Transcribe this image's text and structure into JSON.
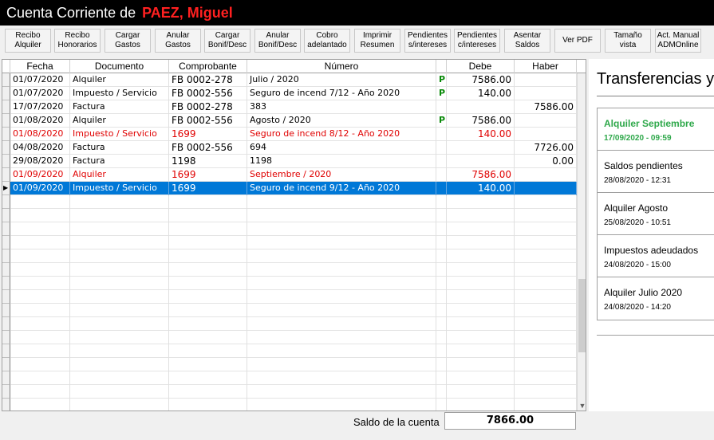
{
  "window": {
    "title_prefix": "Cuenta Corriente de",
    "client_name": "PAEZ, Miguel"
  },
  "toolbar": [
    "Recibo\nAlquiler",
    "Recibo\nHonorarios",
    "Cargar\nGastos",
    "Anular\nGastos",
    "Cargar\nBonif/Desc",
    "Anular\nBonif/Desc",
    "Cobro\nadelantado",
    "Imprimir\nResumen",
    "Pendientes\ns/intereses",
    "Pendientes\nc/intereses",
    "Asentar\nSaldos",
    "Ver PDF",
    "Tamaño vista",
    "Act. Manual\nADMOnline"
  ],
  "grid": {
    "columns": [
      "Fecha",
      "Documento",
      "Comprobante",
      "Número",
      "",
      "Debe",
      "Haber"
    ],
    "rows": [
      {
        "fecha": "01/07/2020",
        "documento": "Alquiler",
        "comprobante": "FB 0002-278",
        "numero": "Julio / 2020",
        "flag": "P",
        "debe": "7586.00",
        "haber": "",
        "style": "normal"
      },
      {
        "fecha": "01/07/2020",
        "documento": "Impuesto / Servicio",
        "comprobante": "FB 0002-556",
        "numero": "Seguro de incend 7/12 - Año 2020",
        "flag": "P",
        "debe": "140.00",
        "haber": "",
        "style": "normal"
      },
      {
        "fecha": "17/07/2020",
        "documento": "Factura",
        "comprobante": "FB 0002-278",
        "numero": "383",
        "flag": "",
        "debe": "",
        "haber": "7586.00",
        "style": "normal"
      },
      {
        "fecha": "01/08/2020",
        "documento": "Alquiler",
        "comprobante": "FB 0002-556",
        "numero": "Agosto / 2020",
        "flag": "P",
        "debe": "7586.00",
        "haber": "",
        "style": "normal"
      },
      {
        "fecha": "01/08/2020",
        "documento": "Impuesto / Servicio",
        "comprobante": "1699",
        "numero": "Seguro de incend 8/12 - Año 2020",
        "flag": "",
        "debe": "140.00",
        "haber": "",
        "style": "red"
      },
      {
        "fecha": "04/08/2020",
        "documento": "Factura",
        "comprobante": "FB 0002-556",
        "numero": "694",
        "flag": "",
        "debe": "",
        "haber": "7726.00",
        "style": "normal"
      },
      {
        "fecha": "29/08/2020",
        "documento": "Factura",
        "comprobante": "1198",
        "numero": "1198",
        "flag": "",
        "debe": "",
        "haber": "0.00",
        "style": "normal"
      },
      {
        "fecha": "01/09/2020",
        "documento": "Alquiler",
        "comprobante": "1699",
        "numero": "Septiembre / 2020",
        "flag": "",
        "debe": "7586.00",
        "haber": "",
        "style": "red"
      },
      {
        "fecha": "01/09/2020",
        "documento": "Impuesto / Servicio",
        "comprobante": "1699",
        "numero": "Seguro de incend 9/12 - Año 2020",
        "flag": "",
        "debe": "140.00",
        "haber": "",
        "style": "sel"
      }
    ]
  },
  "saldo": {
    "label": "Saldo de la cuenta",
    "value": "7866.00"
  },
  "panel": {
    "title": "Transferencias y",
    "items": [
      {
        "title": "Alquiler Septiembre",
        "date": "17/09/2020 - 09:59",
        "active": true
      },
      {
        "title": "Saldos pendientes",
        "date": "28/08/2020 - 12:31",
        "active": false
      },
      {
        "title": "Alquiler Agosto",
        "date": "25/08/2020 - 10:51",
        "active": false
      },
      {
        "title": "Impuestos adeudados",
        "date": "24/08/2020 - 15:00",
        "active": false
      },
      {
        "title": "Alquiler Julio 2020",
        "date": "24/08/2020 - 14:20",
        "active": false
      }
    ]
  }
}
